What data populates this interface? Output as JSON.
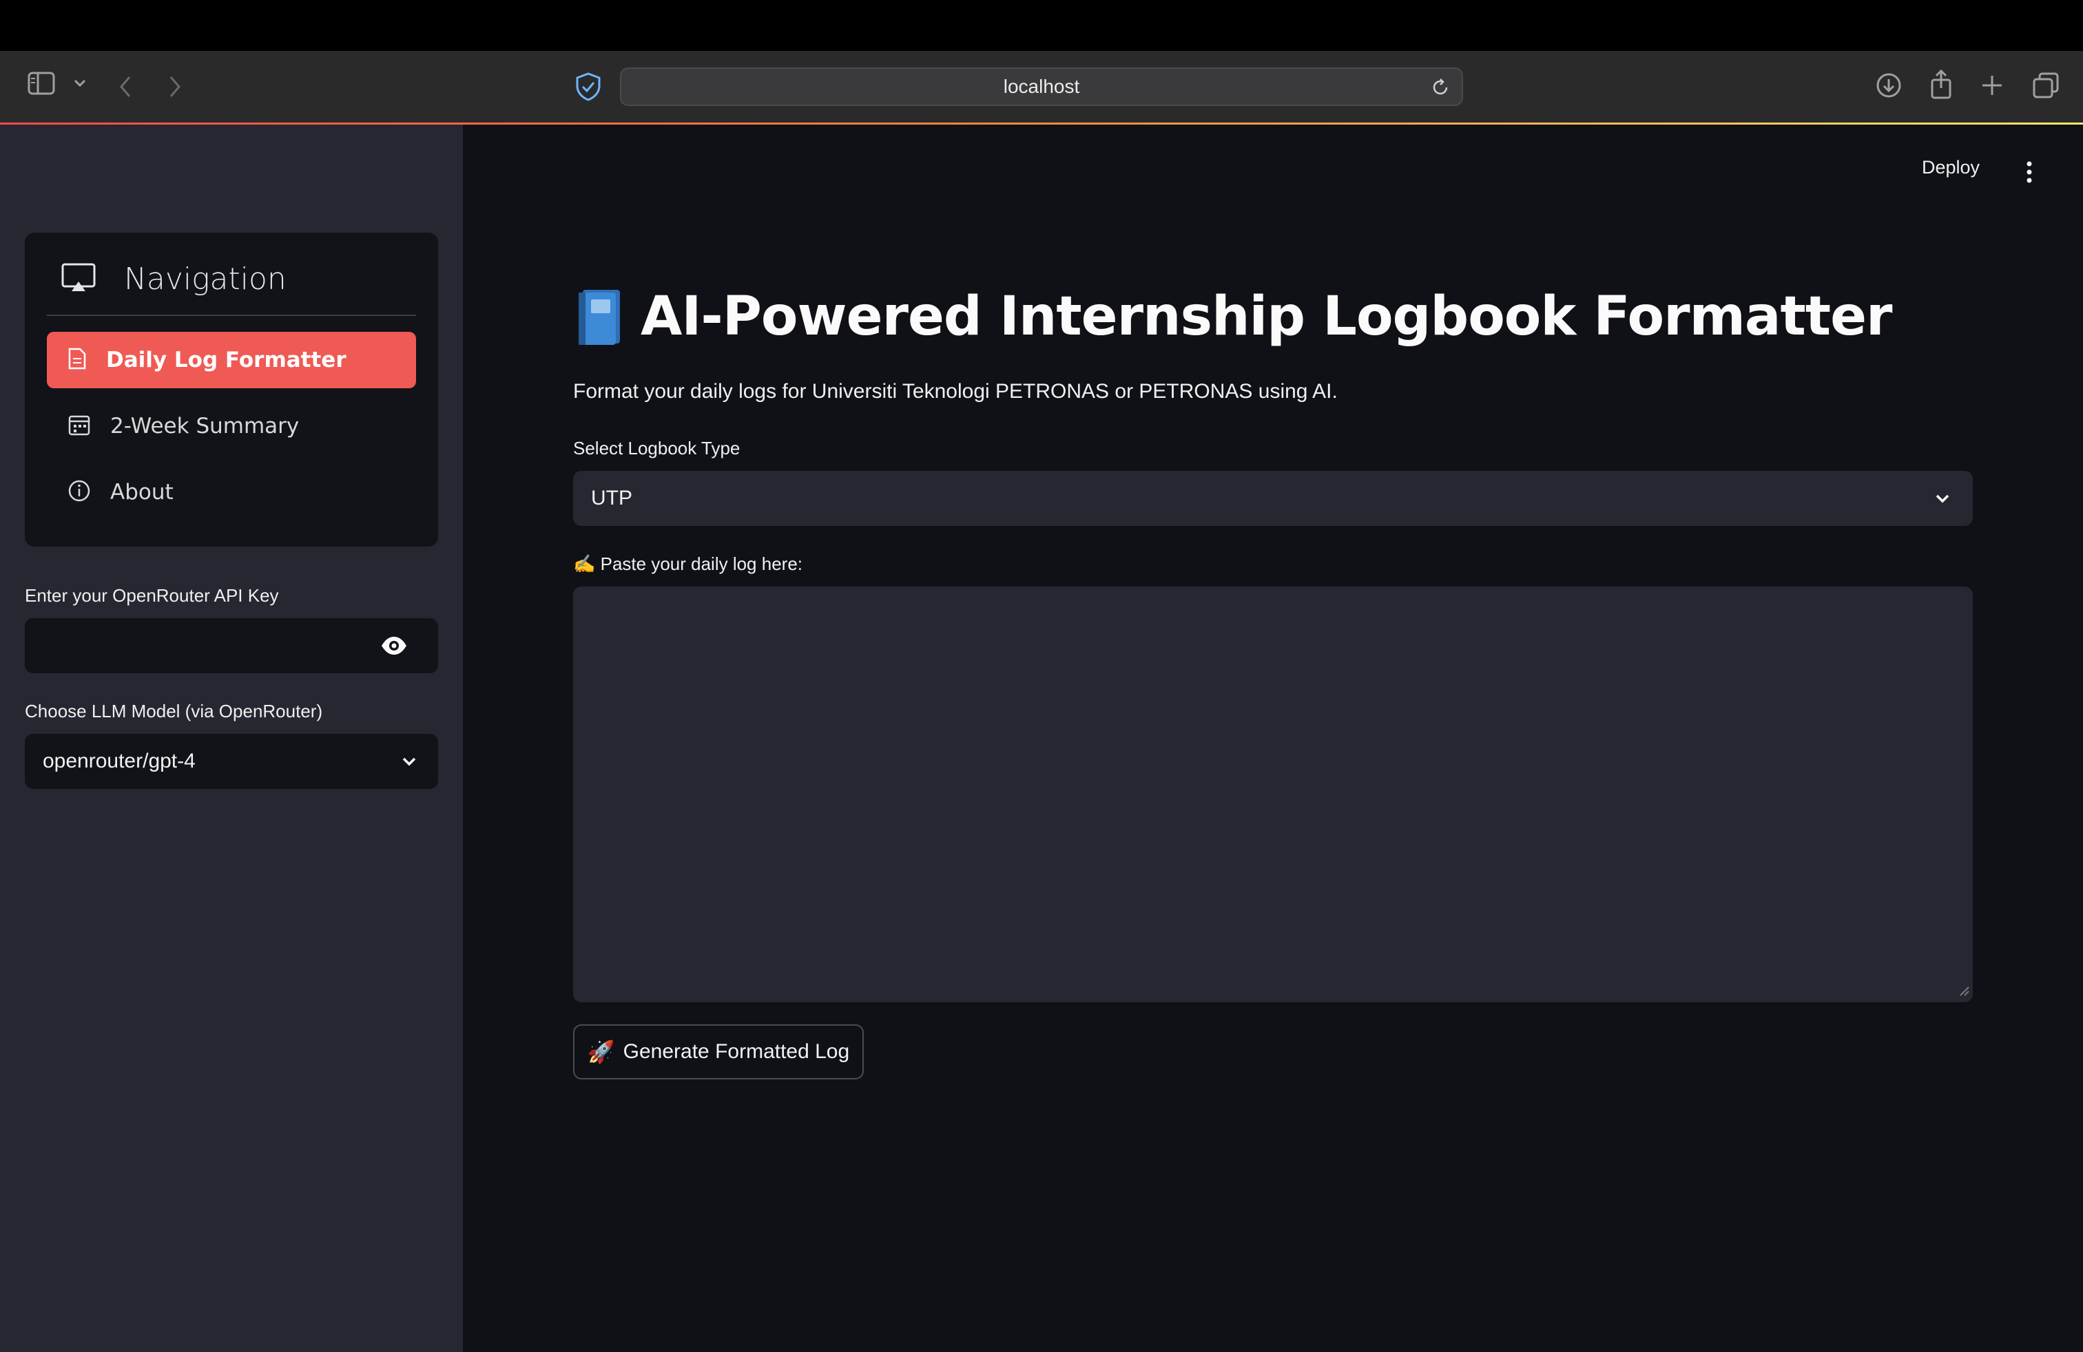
{
  "browser": {
    "url": "localhost"
  },
  "sidebar": {
    "nav_title": "Navigation",
    "items": [
      {
        "label": "Daily Log Formatter",
        "icon": "document-icon",
        "active": true
      },
      {
        "label": "2-Week Summary",
        "icon": "calendar-icon",
        "active": false
      },
      {
        "label": "About",
        "icon": "info-icon",
        "active": false
      }
    ],
    "api_key_label": "Enter your OpenRouter API Key",
    "api_key_value": "",
    "model_label": "Choose LLM Model (via OpenRouter)",
    "model_value": "openrouter/gpt-4"
  },
  "header": {
    "deploy_label": "Deploy"
  },
  "main": {
    "title": "AI-Powered Internship Logbook Formatter",
    "subtitle": "Format your daily logs for Universiti Teknologi PETRONAS or PETRONAS using AI.",
    "logbook_type_label": "Select Logbook Type",
    "logbook_type_value": "UTP",
    "log_input_emoji": "✍️",
    "log_input_label": "Paste your daily log here:",
    "log_input_value": "",
    "generate_emoji": "🚀",
    "generate_label": "Generate Formatted Log"
  },
  "colors": {
    "accent": "#ef5a55",
    "sidebar_bg": "#262730",
    "main_bg": "#0f1116",
    "card_bg": "#111318"
  }
}
